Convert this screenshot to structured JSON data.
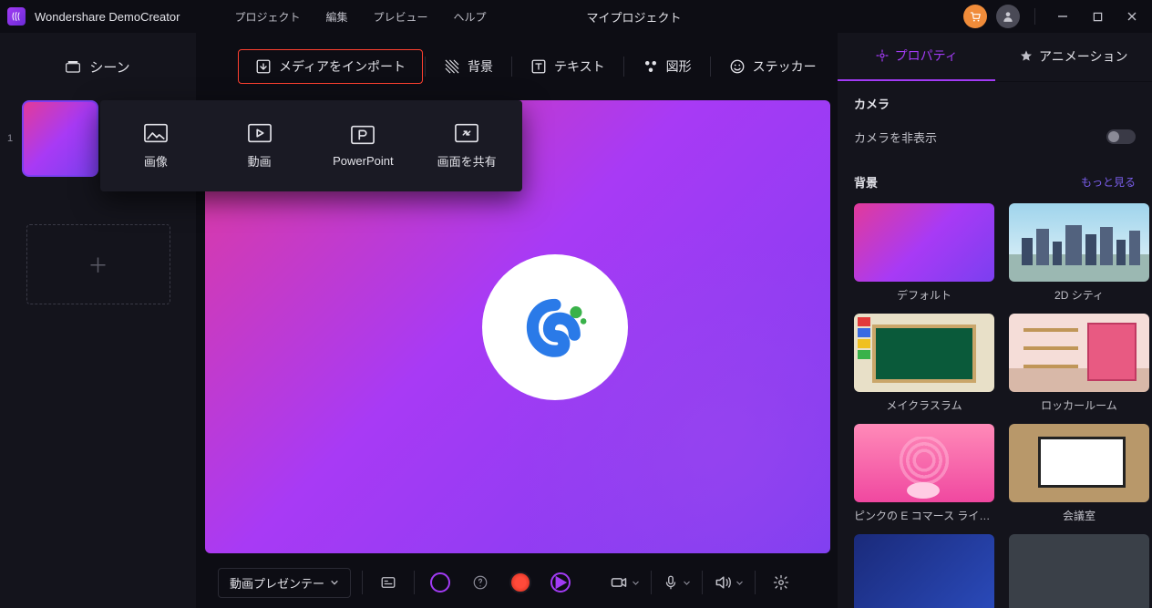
{
  "titlebar": {
    "appName": "Wondershare DemoCreator",
    "menu": [
      "プロジェクト",
      "編集",
      "プレビュー",
      "ヘルプ"
    ],
    "projectName": "マイプロジェクト"
  },
  "sidebar": {
    "title": "シーン",
    "sceneNumber": "1"
  },
  "toolTabs": {
    "import": "メディアをインポート",
    "background": "背景",
    "text": "テキスト",
    "shape": "図形",
    "sticker": "ステッカー"
  },
  "importPopup": {
    "image": "画像",
    "video": "動画",
    "ppt": "PowerPoint",
    "share": "画面を共有"
  },
  "bottomBar": {
    "presenter": "動画プレゼンテー"
  },
  "panel": {
    "tabProperty": "プロパティ",
    "tabAnimation": "アニメーション",
    "camera": "カメラ",
    "hideCamera": "カメラを非表示",
    "background": "背景",
    "viewMore": "もっと見る",
    "bg": {
      "default": "デフォルト",
      "city": "2D シティ",
      "classroom": "メイクラスラム",
      "locker": "ロッカールーム",
      "pink": "ピンクの E コマース ライブ ...",
      "conf": "会議室"
    }
  }
}
